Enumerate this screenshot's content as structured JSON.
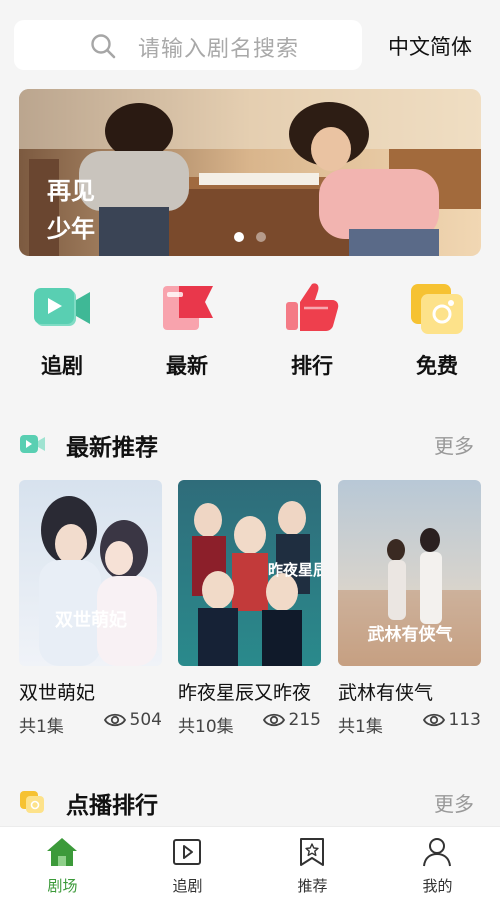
{
  "search": {
    "placeholder": "请输入剧名搜索"
  },
  "language_label": "中文简体",
  "banner": {
    "overlay_text": "再见少年",
    "active_index": 0,
    "count": 2
  },
  "quick_nav": [
    {
      "label": "追剧",
      "icon": "video-camera-icon",
      "color": "#45c8a8"
    },
    {
      "label": "最新",
      "icon": "flag-icon",
      "color": "#ef4a5c"
    },
    {
      "label": "排行",
      "icon": "thumbs-up-icon",
      "color": "#ee3f4d"
    },
    {
      "label": "免费",
      "icon": "coupon-icon",
      "color": "#f6c232"
    }
  ],
  "latest_section": {
    "title": "最新推荐",
    "more": "更多"
  },
  "cards": [
    {
      "title": "双世萌妃",
      "episodes": "共1集",
      "views": "504",
      "poster_text": "双世萌妃"
    },
    {
      "title": "昨夜星辰又昨夜",
      "episodes": "共10集",
      "views": "215",
      "poster_text": "昨夜星辰又一年"
    },
    {
      "title": "武林有侠气",
      "episodes": "共1集",
      "views": "113",
      "poster_text": "武林有侠气"
    }
  ],
  "ranking_section": {
    "title": "点播排行",
    "more": "更多"
  },
  "tabbar": [
    {
      "label": "剧场",
      "icon": "home-icon",
      "active": true
    },
    {
      "label": "追剧",
      "icon": "play-square-icon",
      "active": false
    },
    {
      "label": "推荐",
      "icon": "bookmark-star-icon",
      "active": false
    },
    {
      "label": "我的",
      "icon": "user-icon",
      "active": false
    }
  ],
  "colors": {
    "accent": "#3c9a3a",
    "background": "#f5f5f5"
  }
}
